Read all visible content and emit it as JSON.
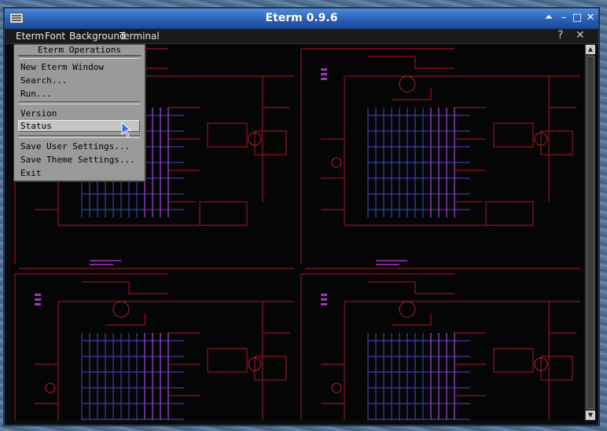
{
  "window": {
    "title": "Eterm 0.9.6",
    "controls": [
      "⏶",
      "–",
      "□",
      "✕"
    ]
  },
  "menubar": {
    "items": [
      "Eterm",
      "Font",
      "Background",
      "Terminal"
    ],
    "help": "?",
    "close": "✕"
  },
  "popup": {
    "title": "Eterm Operations",
    "group1": [
      "New Eterm Window",
      "Search...",
      "Run..."
    ],
    "group2": [
      "Version",
      "Status"
    ],
    "group3": [
      "Save User Settings...",
      "Save Theme Settings...",
      "Exit"
    ],
    "selected": "Status"
  },
  "colors": {
    "titlebar": "#2a5fb6",
    "wire_red": "#8a1520",
    "wire_blue": "#3a4fd0",
    "wire_purple": "#9a3ac0",
    "menu_bg": "#9a9a9a"
  }
}
